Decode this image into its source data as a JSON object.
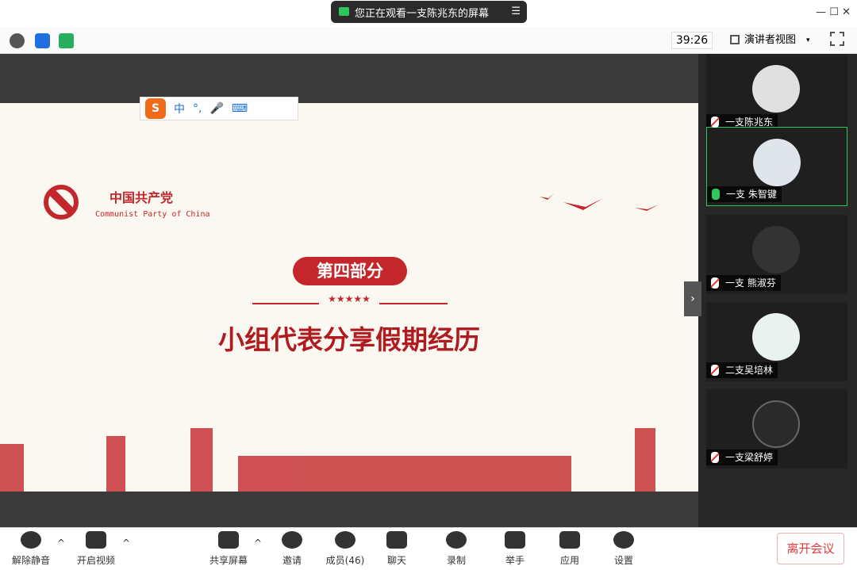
{
  "banner": {
    "text": "您正在观看一支陈兆东的屏幕",
    "menu_icon": "menu-icon"
  },
  "window_controls": {
    "minimize": "—",
    "maximize": "☐",
    "close": "✕"
  },
  "toolbar": {
    "timer": "39:26",
    "view_label": "演讲者视图",
    "view_caret": "▾",
    "icons": [
      "info-icon",
      "shield-icon",
      "signal-icon"
    ]
  },
  "ime": {
    "logo": "S",
    "items": [
      "中",
      "°,",
      "🎤",
      "⌨",
      "👕",
      "⁘"
    ]
  },
  "slide": {
    "party_zh": "中国共产党",
    "party_en": "Communist Party of China",
    "part": "第四部分",
    "stars": "★★★★★",
    "title": "小组代表分享假期经历"
  },
  "participants": [
    {
      "name": "一支陈兆东",
      "mic": "muted",
      "show_name": true
    },
    {
      "name": "一支 朱智键",
      "mic": "active",
      "show_name": true
    },
    {
      "name": "一支 熊淑芬",
      "mic": "muted",
      "show_name": true
    },
    {
      "name": "二支吴培林",
      "mic": "muted",
      "show_name": true
    },
    {
      "name": "一支梁舒婷",
      "mic": "muted",
      "show_name": true
    }
  ],
  "collapse_label": "›",
  "bottombar": {
    "buttons": [
      {
        "label": "解除静音",
        "icon": "mic-muted-icon"
      },
      {
        "label": "开启视频",
        "icon": "video-off-icon"
      },
      {
        "label": "共享屏幕",
        "icon": "share-screen-icon"
      },
      {
        "label": "邀请",
        "icon": "invite-icon"
      },
      {
        "label": "成员(46)",
        "icon": "members-icon"
      },
      {
        "label": "聊天",
        "icon": "chat-icon"
      },
      {
        "label": "录制",
        "icon": "record-icon"
      },
      {
        "label": "举手",
        "icon": "raise-hand-icon"
      },
      {
        "label": "应用",
        "icon": "apps-icon"
      },
      {
        "label": "设置",
        "icon": "settings-icon"
      }
    ],
    "caret": "^",
    "leave": "离开会议"
  },
  "colors": {
    "accent": "#c3272b",
    "mic_active": "#2ec75a",
    "leave": "#e4393c"
  }
}
